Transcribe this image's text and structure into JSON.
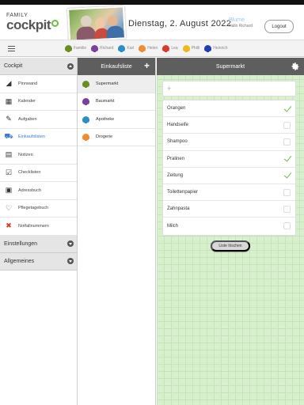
{
  "header": {
    "logo_family": "FAMILY",
    "logo_text": "cockpit",
    "date": "Dienstag, 2. August 2022",
    "user_name": "Blume",
    "greeting": "Hallo Richard",
    "logout_label": "Logout"
  },
  "family": {
    "members": [
      {
        "name": "Familie",
        "color": "#6b8e23"
      },
      {
        "name": "Richard",
        "color": "#7b3fa0"
      },
      {
        "name": "Karl",
        "color": "#2a8fc8"
      },
      {
        "name": "Helen",
        "color": "#f28a2e"
      },
      {
        "name": "Lea",
        "color": "#d93a2a"
      },
      {
        "name": "Philli",
        "color": "#f0b81c"
      },
      {
        "name": "Heinrich",
        "color": "#1f3fb5"
      }
    ]
  },
  "sidebar": {
    "section_cockpit": "Cockpit",
    "items": [
      {
        "label": "Pinnwand",
        "icon": "pin-icon"
      },
      {
        "label": "Kalender",
        "icon": "calendar-icon"
      },
      {
        "label": "Aufgaben",
        "icon": "tasks-icon"
      },
      {
        "label": "Einkaufslisten",
        "icon": "cart-icon"
      },
      {
        "label": "Notizen",
        "icon": "note-icon"
      },
      {
        "label": "Checklisten",
        "icon": "checklist-icon"
      },
      {
        "label": "Adressbuch",
        "icon": "address-book-icon"
      },
      {
        "label": "Pflegetagebuch",
        "icon": "heart-icon"
      },
      {
        "label": "Notfallnummern",
        "icon": "emergency-icon"
      }
    ],
    "section_settings": "Einstellungen",
    "section_general": "Allgemeines"
  },
  "lists": {
    "title": "Einkaufsliste",
    "items": [
      {
        "label": "Supermarkt",
        "color": "#6b8e23"
      },
      {
        "label": "Baumarkt",
        "color": "#7b3fa0"
      },
      {
        "label": "Apotheke",
        "color": "#2a8fc8"
      },
      {
        "label": "Drogerie",
        "color": "#f28a2e"
      }
    ]
  },
  "detail": {
    "title": "Supermarkt",
    "add_placeholder": "+",
    "items": [
      {
        "label": "Orangen",
        "checked": true
      },
      {
        "label": "Handseife",
        "checked": false
      },
      {
        "label": "Shampoo",
        "checked": false
      },
      {
        "label": "Pralinen",
        "checked": true
      },
      {
        "label": "Zeitung",
        "checked": true
      },
      {
        "label": "Toilettenpapier",
        "checked": false
      },
      {
        "label": "Zahnpasta",
        "checked": false
      },
      {
        "label": "Milch",
        "checked": false
      }
    ],
    "clear_label": "Liste löschen"
  },
  "colors": {
    "accent_green": "#6dbb45",
    "active_blue": "#3a7bd5",
    "panel_head": "#5e5e5e",
    "grid_bg": "#d9f0cf"
  }
}
